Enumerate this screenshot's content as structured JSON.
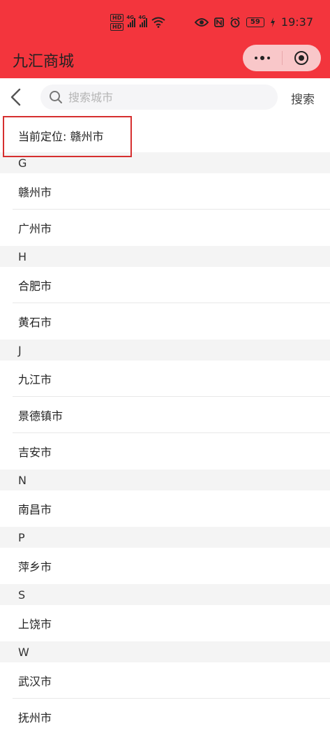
{
  "status_bar": {
    "hd1": "HD",
    "hd2": "HD",
    "net1": "4G",
    "net2": "4G",
    "battery": "59",
    "time": "19:37"
  },
  "header": {
    "title": "九汇商城",
    "background": "#f3353d"
  },
  "search": {
    "placeholder": "搜索城市",
    "button_label": "搜索"
  },
  "current_location": "当前定位: 赣州市",
  "groups": [
    {
      "letter": "G",
      "cities": [
        "赣州市",
        "广州市"
      ]
    },
    {
      "letter": "H",
      "cities": [
        "合肥市",
        "黄石市"
      ]
    },
    {
      "letter": "J",
      "cities": [
        "九江市",
        "景德镇市",
        "吉安市"
      ]
    },
    {
      "letter": "N",
      "cities": [
        "南昌市"
      ]
    },
    {
      "letter": "P",
      "cities": [
        "萍乡市"
      ]
    },
    {
      "letter": "S",
      "cities": [
        "上饶市"
      ]
    },
    {
      "letter": "W",
      "cities": [
        "武汉市",
        "抚州市"
      ]
    }
  ]
}
